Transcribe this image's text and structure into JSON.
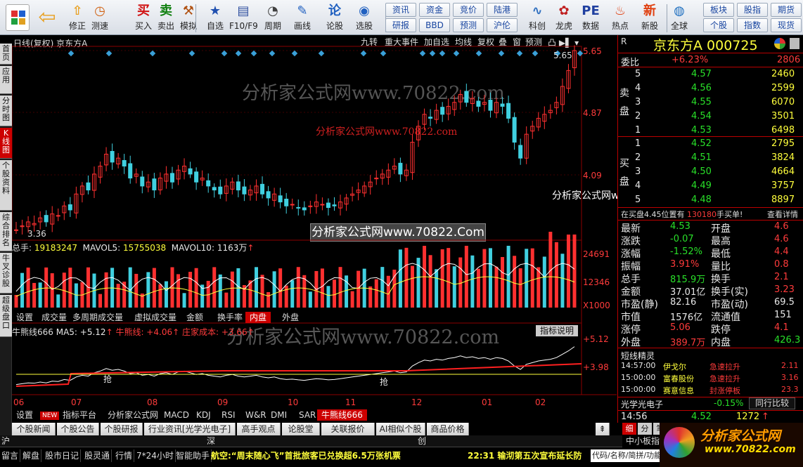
{
  "toolbar": {
    "items": [
      {
        "label": "修正",
        "icon": "up-arrow-icon",
        "color": "#e8a020"
      },
      {
        "label": "测速",
        "icon": "clock-icon",
        "color": "#d06010"
      },
      {
        "label": "买入",
        "icon": "buy-icon",
        "color": "#d01010"
      },
      {
        "label": "卖出",
        "icon": "sell-icon",
        "color": "#108010"
      },
      {
        "label": "模拟",
        "icon": "hammer-icon",
        "color": "#b05010"
      },
      {
        "label": "自选",
        "icon": "star-folder-icon",
        "color": "#2050b0"
      },
      {
        "label": "F10/F9",
        "icon": "f10-icon",
        "color": "#3050a0"
      },
      {
        "label": "周期",
        "icon": "clock-cycle-icon",
        "color": "#404040"
      },
      {
        "label": "画线",
        "icon": "pencil-icon",
        "color": "#2060c0"
      },
      {
        "label": "论股",
        "icon": "discuss-icon",
        "color": "#2060c0"
      },
      {
        "label": "选股",
        "icon": "select-stock-icon",
        "color": "#2060c0"
      },
      {
        "label": "科创",
        "icon": "tech-icon",
        "color": "#3070c0"
      },
      {
        "label": "龙虎",
        "icon": "dragon-icon",
        "color": "#c02020"
      },
      {
        "label": "数据",
        "icon": "pe-data-icon",
        "color": "#2040a0"
      },
      {
        "label": "热点",
        "icon": "fire-icon",
        "color": "#e04010"
      },
      {
        "label": "新股",
        "icon": "new-stock-icon",
        "color": "#e04010"
      },
      {
        "label": "全球",
        "icon": "globe-icon",
        "color": "#2070c0"
      }
    ],
    "text_buttons": [
      [
        "资讯",
        "研报"
      ],
      [
        "资金",
        "BBD"
      ],
      [
        "竞价",
        "预测"
      ],
      [
        "陆港",
        "沪伦"
      ]
    ],
    "right_buttons": [
      [
        "板块",
        "个股"
      ],
      [
        "股指",
        "指数"
      ],
      [
        "期货",
        "现货"
      ]
    ]
  },
  "left_tabs": [
    "首页",
    "应用",
    "分时图",
    "K线图",
    "个股资料",
    "综合排名",
    "牛叉诊股",
    "超级盘口"
  ],
  "chart": {
    "title": "日线(复权)  京东方A",
    "top_tabs": [
      "九转",
      "重大事件",
      "加自选",
      "均线",
      "复权",
      "叠",
      "窗",
      "预测"
    ],
    "price_labels": [
      "5.65",
      "4.87",
      "4.09"
    ],
    "high_label": "5.65",
    "low_label": "3.36",
    "volume": {
      "summary_label": "总手:",
      "summary_value": "19183247",
      "mavol5_label": "MAVOL5:",
      "mavol5_value": "15755038",
      "mavol10_label": "MAVOL10:",
      "mavol10_value": "1163万",
      "axis": [
        "24691",
        "12346",
        "X1000"
      ]
    },
    "volume_tabs": [
      "设置",
      "成交量",
      "多周期成交量",
      "虚拟成交量",
      "金额",
      "换手率",
      "内盘",
      "外盘"
    ],
    "indicator": {
      "name": "牛熊线666",
      "ma5": "MA5: +5.12",
      "bull": "牛熊线: +4.06",
      "cost": "庄家成本: +3.66",
      "help": "指标说明",
      "labels": [
        "+5.12",
        "+3.98"
      ],
      "signal": "抢"
    },
    "x_labels": [
      "06",
      "07",
      "08",
      "09",
      "10",
      "11",
      "12",
      "01",
      "02"
    ],
    "bottom_tabs": [
      "设置",
      "NEW",
      "指标平台",
      "分析家公式网",
      "MACD",
      "KDJ",
      "RSI",
      "W&R",
      "DMI",
      "SAR",
      "牛熊线666"
    ],
    "nav_tabs": [
      "个股新闻",
      "个股公告",
      "个股研报",
      "行业资讯[光学光电子]",
      "高手观点",
      "论股堂",
      "关联报价",
      "AI相似个股",
      "商品价格"
    ],
    "watermark": "分析家公式网www.70822.com",
    "watermark2": "分析家公式网www.70822.com",
    "watermark3": "分析家公式网www.70822.Com",
    "watermark4": "分析家公式网www.70822.Com"
  },
  "quote": {
    "name": "京东方A",
    "code": "000725",
    "weibi_label": "委比",
    "weibi_value": "+6.23%",
    "weibi_num": "2806",
    "sell_label": "卖盘",
    "buy_label": "买盘",
    "sell": [
      [
        "5",
        "4.57",
        "2460"
      ],
      [
        "4",
        "4.56",
        "2599"
      ],
      [
        "3",
        "4.55",
        "6070"
      ],
      [
        "2",
        "4.54",
        "3501"
      ],
      [
        "1",
        "4.53",
        "6498"
      ]
    ],
    "buy": [
      [
        "1",
        "4.52",
        "2795"
      ],
      [
        "2",
        "4.51",
        "3824"
      ],
      [
        "3",
        "4.50",
        "4664"
      ],
      [
        "4",
        "4.49",
        "3757"
      ],
      [
        "5",
        "4.48",
        "8897"
      ]
    ],
    "alert": "在买盘4.45位置有",
    "alert_num": "130180",
    "alert_tail": "手买单!",
    "alert_link": "查看详情",
    "stats": [
      [
        "最新",
        "4.53",
        "开盘",
        "4.6"
      ],
      [
        "涨跌",
        "-0.07",
        "最高",
        "4.6"
      ],
      [
        "涨幅",
        "-1.52%",
        "最低",
        "4.4"
      ],
      [
        "振幅",
        "3.91%",
        "量比",
        "0.8"
      ],
      [
        "总手",
        "815.9万",
        "换手",
        "2.1"
      ],
      [
        "金额",
        "37.01亿",
        "换手(实)",
        "3.23"
      ],
      [
        "市盈(静)",
        "82.16",
        "市盈(动)",
        "69.5"
      ],
      [
        "市值",
        "1576亿",
        "流通值",
        "151"
      ],
      [
        "涨停",
        "5.06",
        "跌停",
        "4.1"
      ],
      [
        "外盘",
        "389.7万",
        "内盘",
        "426.3"
      ]
    ],
    "jingling_title": "短线精灵",
    "jingling": [
      [
        "14:57:00",
        "伊戈尔",
        "急速拉升",
        "2.11"
      ],
      [
        "15:00:00",
        "富春股份",
        "急速拉升",
        "3.16"
      ],
      [
        "15:00:00",
        "赛意信息",
        "封涨停板",
        "23.3"
      ]
    ],
    "industry": "光学光电子",
    "industry_change": "-0.15%",
    "compare": "同行比较",
    "last_time": "14:56",
    "last_price": "4.52",
    "last_vol": "1272",
    "bottom_tabs": [
      "细",
      "分",
      "笔",
      "价",
      "操"
    ]
  },
  "status": {
    "market_tabs": [
      "沪",
      "深",
      "创",
      "中小板指"
    ],
    "bottom_items": [
      "留言",
      "解盘",
      "股市日记",
      "股灵通",
      "行情",
      "7*24小时",
      "智能助手"
    ],
    "ticker": "航空:“周末随心飞”首批旅客已兑换超6.5万张机票",
    "ticker2": "22:31 输沏第五次宣布延长防",
    "search": "代码/名称/简拼/功能",
    "logo": "分析家公式网",
    "logo_url": "www.70822.com"
  }
}
